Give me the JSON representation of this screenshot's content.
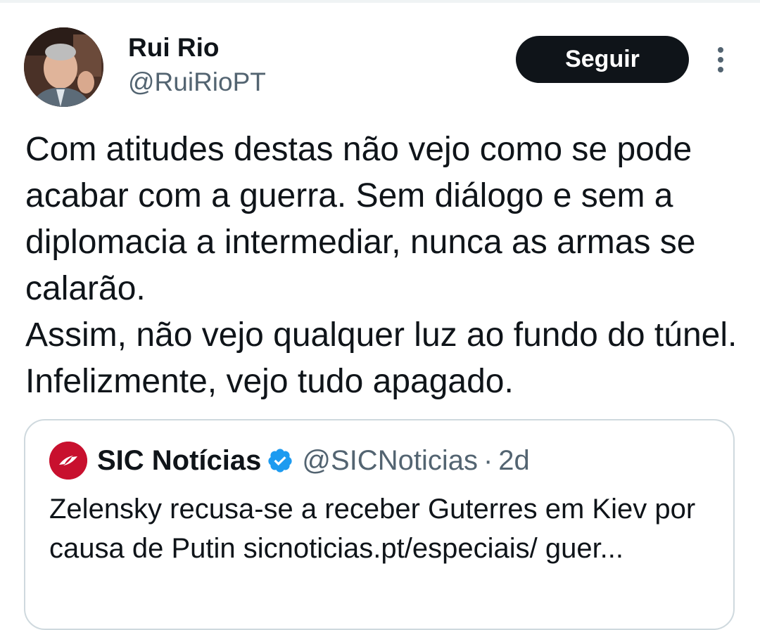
{
  "author": {
    "display_name": "Rui Rio",
    "handle": "@RuiRioPT",
    "avatar": "profile-photo"
  },
  "actions": {
    "follow_label": "Seguir",
    "more_icon": "vertical-ellipsis-icon"
  },
  "tweet": {
    "text": "Com atitudes destas não vejo como se pode acabar com a guerra. Sem diálogo e sem a diplomacia a intermediar, nunca as armas se calarão.\nAssim, não vejo qualquer luz ao fundo do túnel. Infelizmente, vejo tudo apagado."
  },
  "quote": {
    "author_name": "SIC Notícias",
    "verified_icon": "verified-badge-icon",
    "handle": "@SICNoticias",
    "separator": "·",
    "time": "2d",
    "text": "Zelensky recusa-se a receber Guterres em Kiev por causa de Putin sicnoticias.pt/especiais/ guer..."
  },
  "colors": {
    "text_primary": "#0f1419",
    "text_secondary": "#536471",
    "button_bg": "#0f1419",
    "button_text": "#ffffff",
    "border": "#cfd9de",
    "verified": "#1d9bf0",
    "sic_brand": "#c8102e"
  }
}
